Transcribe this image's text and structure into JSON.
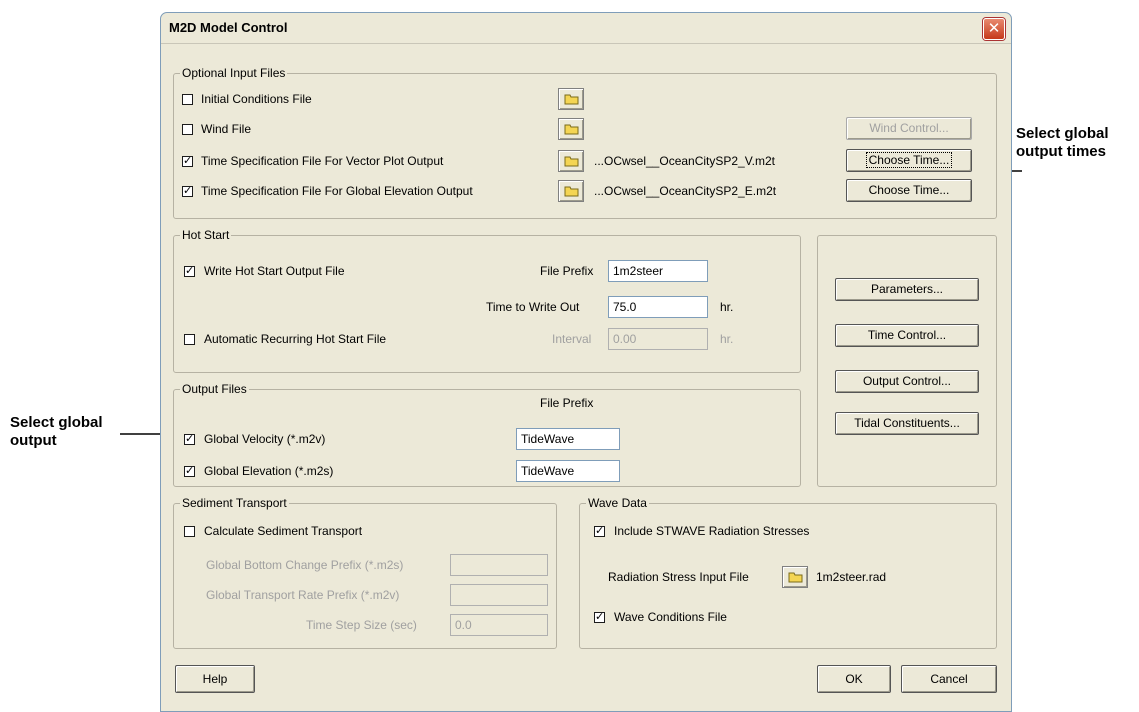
{
  "window": {
    "title": "M2D Model Control",
    "close_glyph": "✕"
  },
  "optional_input": {
    "legend": "Optional Input Files",
    "rows": [
      {
        "label": "Initial Conditions File",
        "checked": false,
        "file": ""
      },
      {
        "label": "Wind File",
        "checked": false,
        "file": ""
      },
      {
        "label": "Time Specification File For Vector Plot Output",
        "checked": true,
        "file": "...OCwsel__OceanCitySP2_V.m2t"
      },
      {
        "label": "Time Specification File For Global Elevation Output",
        "checked": true,
        "file": "...OCwsel__OceanCitySP2_E.m2t"
      }
    ],
    "wind_control_label": "Wind Control...",
    "choose_time_label": "Choose Time..."
  },
  "hot_start": {
    "legend": "Hot Start",
    "write_label": "Write Hot Start Output File",
    "write_checked": true,
    "file_prefix_label": "File Prefix",
    "file_prefix_value": "1m2steer",
    "time_label": "Time to Write Out",
    "time_value": "75.0",
    "unit": "hr.",
    "recurring_label": "Automatic Recurring Hot Start File",
    "recurring_checked": false,
    "interval_label": "Interval",
    "interval_value": "0.00"
  },
  "side_buttons": {
    "parameters": "Parameters...",
    "time_control": "Time Control...",
    "output_control": "Output Control...",
    "tidal": "Tidal Constituents..."
  },
  "output_files": {
    "legend": "Output Files",
    "file_prefix_header": "File Prefix",
    "velocity_label": "Global Velocity (*.m2v)",
    "velocity_value": "TideWave",
    "elevation_label": "Global Elevation (*.m2s)",
    "elevation_value": "TideWave"
  },
  "sediment": {
    "legend": "Sediment Transport",
    "calc_label": "Calculate Sediment Transport",
    "bottom_label": "Global Bottom Change Prefix (*.m2s)",
    "rate_label": "Global Transport Rate Prefix (*.m2v)",
    "step_label": "Time Step Size (sec)",
    "step_value": "0.0"
  },
  "wave": {
    "legend": "Wave Data",
    "stwave_label": "Include STWAVE Radiation Stresses",
    "radiation_label": "Radiation Stress Input File",
    "radiation_file": "1m2steer.rad",
    "conditions_label": "Wave Conditions File"
  },
  "footer": {
    "help": "Help",
    "ok": "OK",
    "cancel": "Cancel"
  },
  "annotations": {
    "times_line1": "Select global",
    "times_line2": "output times",
    "output_line1": "Select global",
    "output_line2": "output"
  },
  "check_glyph": "✓",
  "icons": [
    "folder-icon",
    "close-icon",
    "arrow-icon"
  ]
}
